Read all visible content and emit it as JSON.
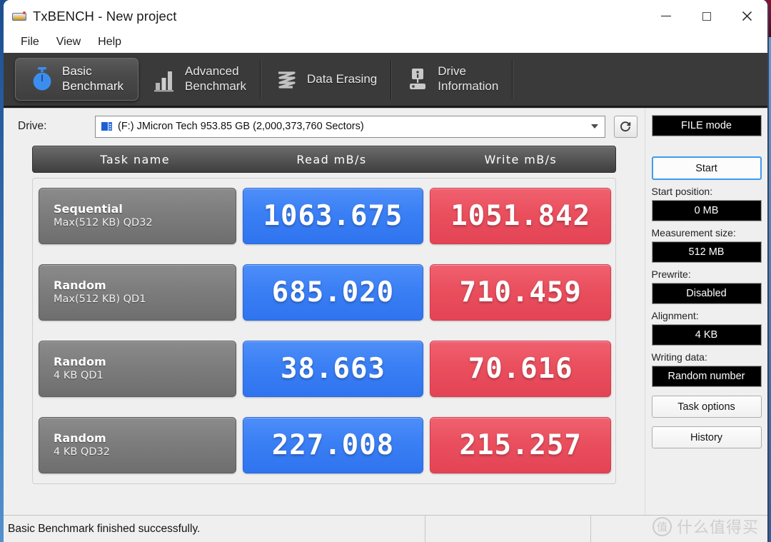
{
  "window": {
    "title": "TxBENCH - New project",
    "app_icon": "drive-icon",
    "minimize_label": "–",
    "maximize_label": "□",
    "close_label": "✕"
  },
  "menu": {
    "items": [
      {
        "label": "File"
      },
      {
        "label": "View"
      },
      {
        "label": "Help"
      }
    ]
  },
  "tabs": [
    {
      "label": "Basic\nBenchmark",
      "icon": "stopwatch-icon",
      "active": true
    },
    {
      "label": "Advanced\nBenchmark",
      "icon": "bar-chart-icon",
      "active": false
    },
    {
      "label": "Data Erasing",
      "icon": "shred-icon",
      "active": false
    },
    {
      "label": "Drive\nInformation",
      "icon": "drive-info-icon",
      "active": false
    }
  ],
  "drive": {
    "label": "Drive:",
    "value": "(F:) JMicron Tech  953.85 GB (2,000,373,760 Sectors)",
    "icon": "drive-small-icon",
    "refresh_icon": "refresh-icon",
    "caret_icon": "chevron-down-icon"
  },
  "table": {
    "headers": [
      "Task name",
      "Read mB/s",
      "Write mB/s"
    ],
    "rows": [
      {
        "task_line1": "Sequential",
        "task_line2": "Max(512 KB) QD32",
        "read": "1063.675",
        "write": "1051.842"
      },
      {
        "task_line1": "Random",
        "task_line2": "Max(512 KB) QD1",
        "read": "685.020",
        "write": "710.459"
      },
      {
        "task_line1": "Random",
        "task_line2": "4 KB QD1",
        "read": "38.663",
        "write": "70.616"
      },
      {
        "task_line1": "Random",
        "task_line2": "4 KB QD32",
        "read": "227.008",
        "write": "215.257"
      }
    ]
  },
  "sidebar": {
    "mode_value": "FILE mode",
    "start_label": "Start",
    "start_position_label": "Start position:",
    "start_position_value": "0 MB",
    "measurement_size_label": "Measurement size:",
    "measurement_size_value": "512 MB",
    "prewrite_label": "Prewrite:",
    "prewrite_value": "Disabled",
    "alignment_label": "Alignment:",
    "alignment_value": "4 KB",
    "writing_data_label": "Writing data:",
    "writing_data_value": "Random number",
    "task_options_label": "Task options",
    "history_label": "History"
  },
  "status": {
    "message": "Basic Benchmark finished successfully.",
    "section2": "",
    "section3": ""
  },
  "watermark": {
    "badge": "值",
    "text": "什么值得买"
  },
  "colors": {
    "read_blue": "#3b7ff5",
    "write_red": "#ea4f5e",
    "tabstrip": "#3a3a3a",
    "accent_focus": "#3f9bf0"
  }
}
